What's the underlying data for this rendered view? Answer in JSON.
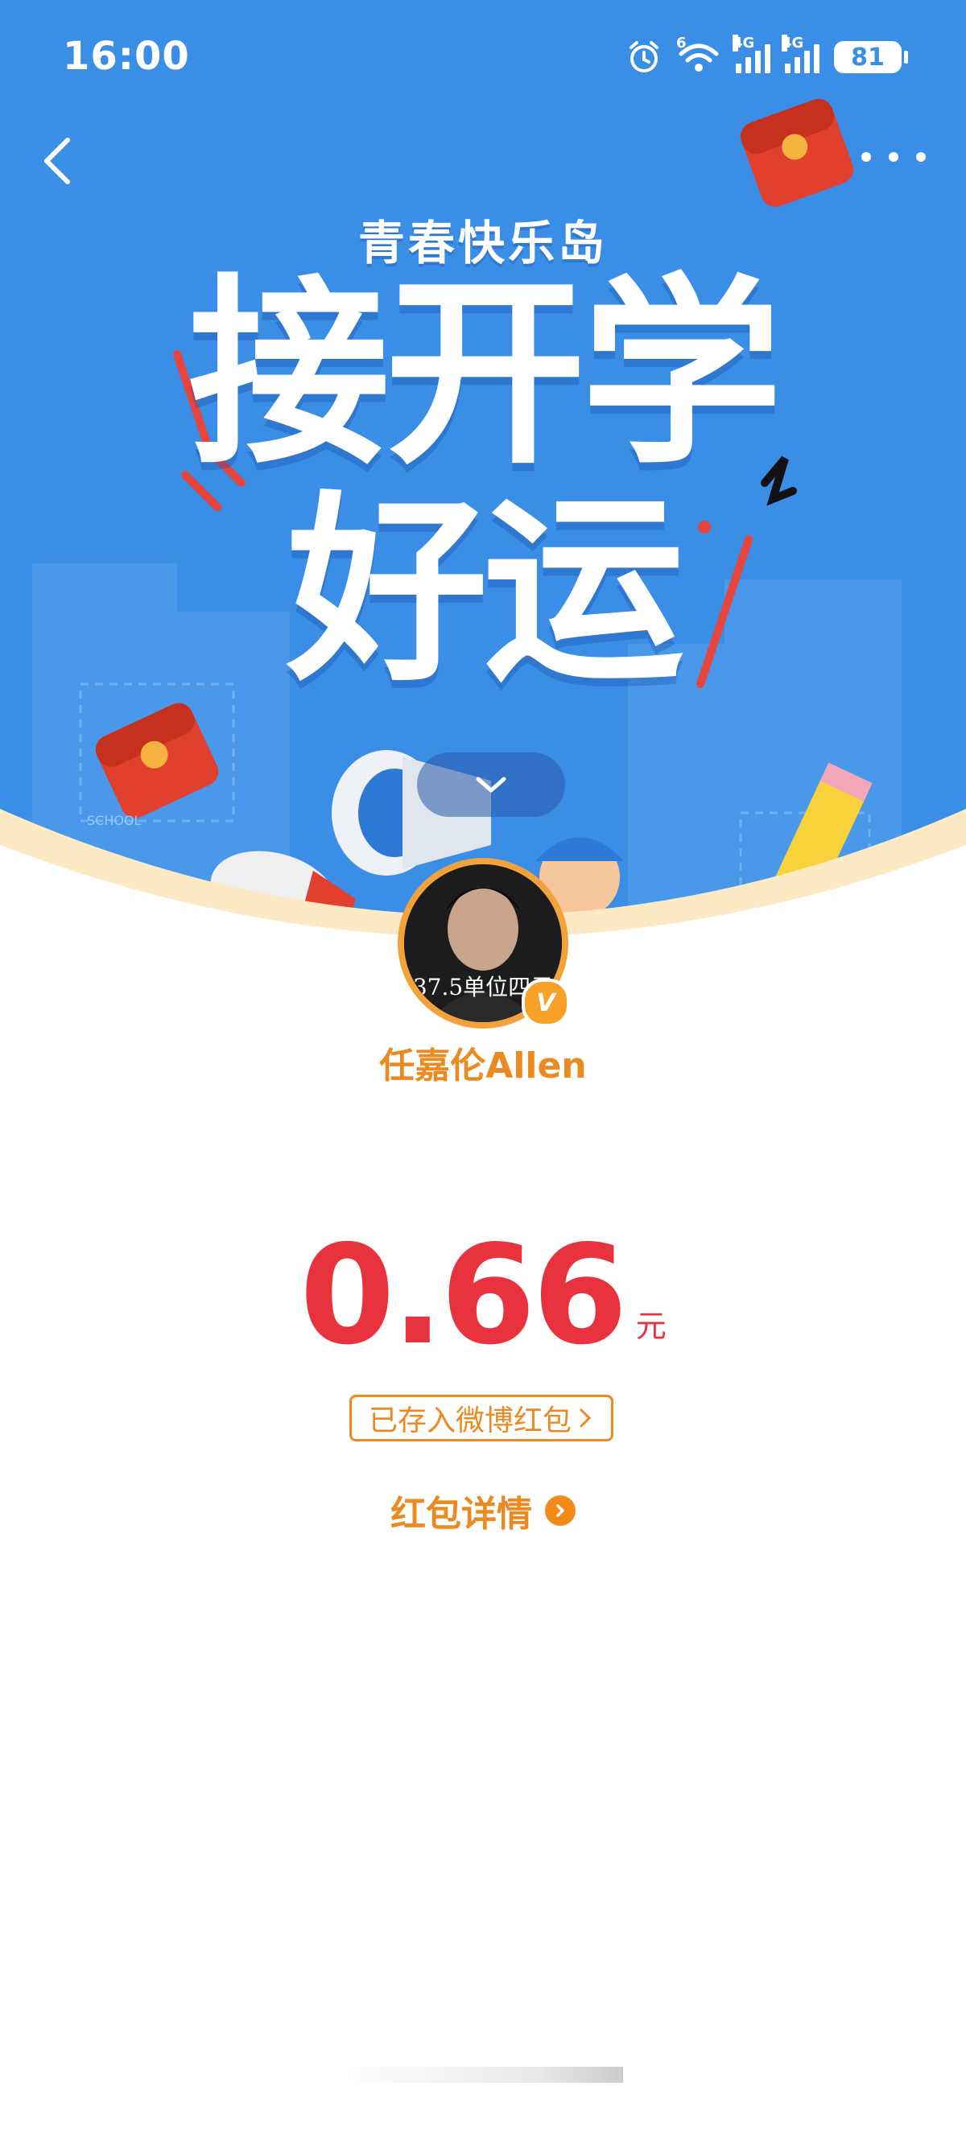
{
  "status_bar": {
    "time": "16:00",
    "wifi_badge": "6",
    "sim1_net": "4G",
    "sim2_net": "4G",
    "battery": "81",
    "alarm_icon": "alarm-icon",
    "wifi_icon": "wifi-icon"
  },
  "nav": {
    "back_icon": "chevron-left-icon",
    "more_icon": "more-dots-icon"
  },
  "banner": {
    "subtitle": "青春快乐岛",
    "headline_line1": "接开学",
    "headline_line2": "好运",
    "school_label": "SCHOOL",
    "expand_icon": "chevron-down-icon",
    "colors": {
      "sky": "#3a8ee6",
      "accent_red": "#e8333e",
      "cream": "#fde9c4"
    }
  },
  "sender": {
    "avatar_caption": "37.5单位四元",
    "verified_mark": "V",
    "name": "任嘉伦Allen"
  },
  "red_packet": {
    "amount": "0.66",
    "unit": "元",
    "status": "已存入微博红包",
    "details_label": "红包详情",
    "details_icon": "chevron-right-circle-icon"
  },
  "theme": {
    "orange": "#ec8a22",
    "red": "#e8333e"
  }
}
